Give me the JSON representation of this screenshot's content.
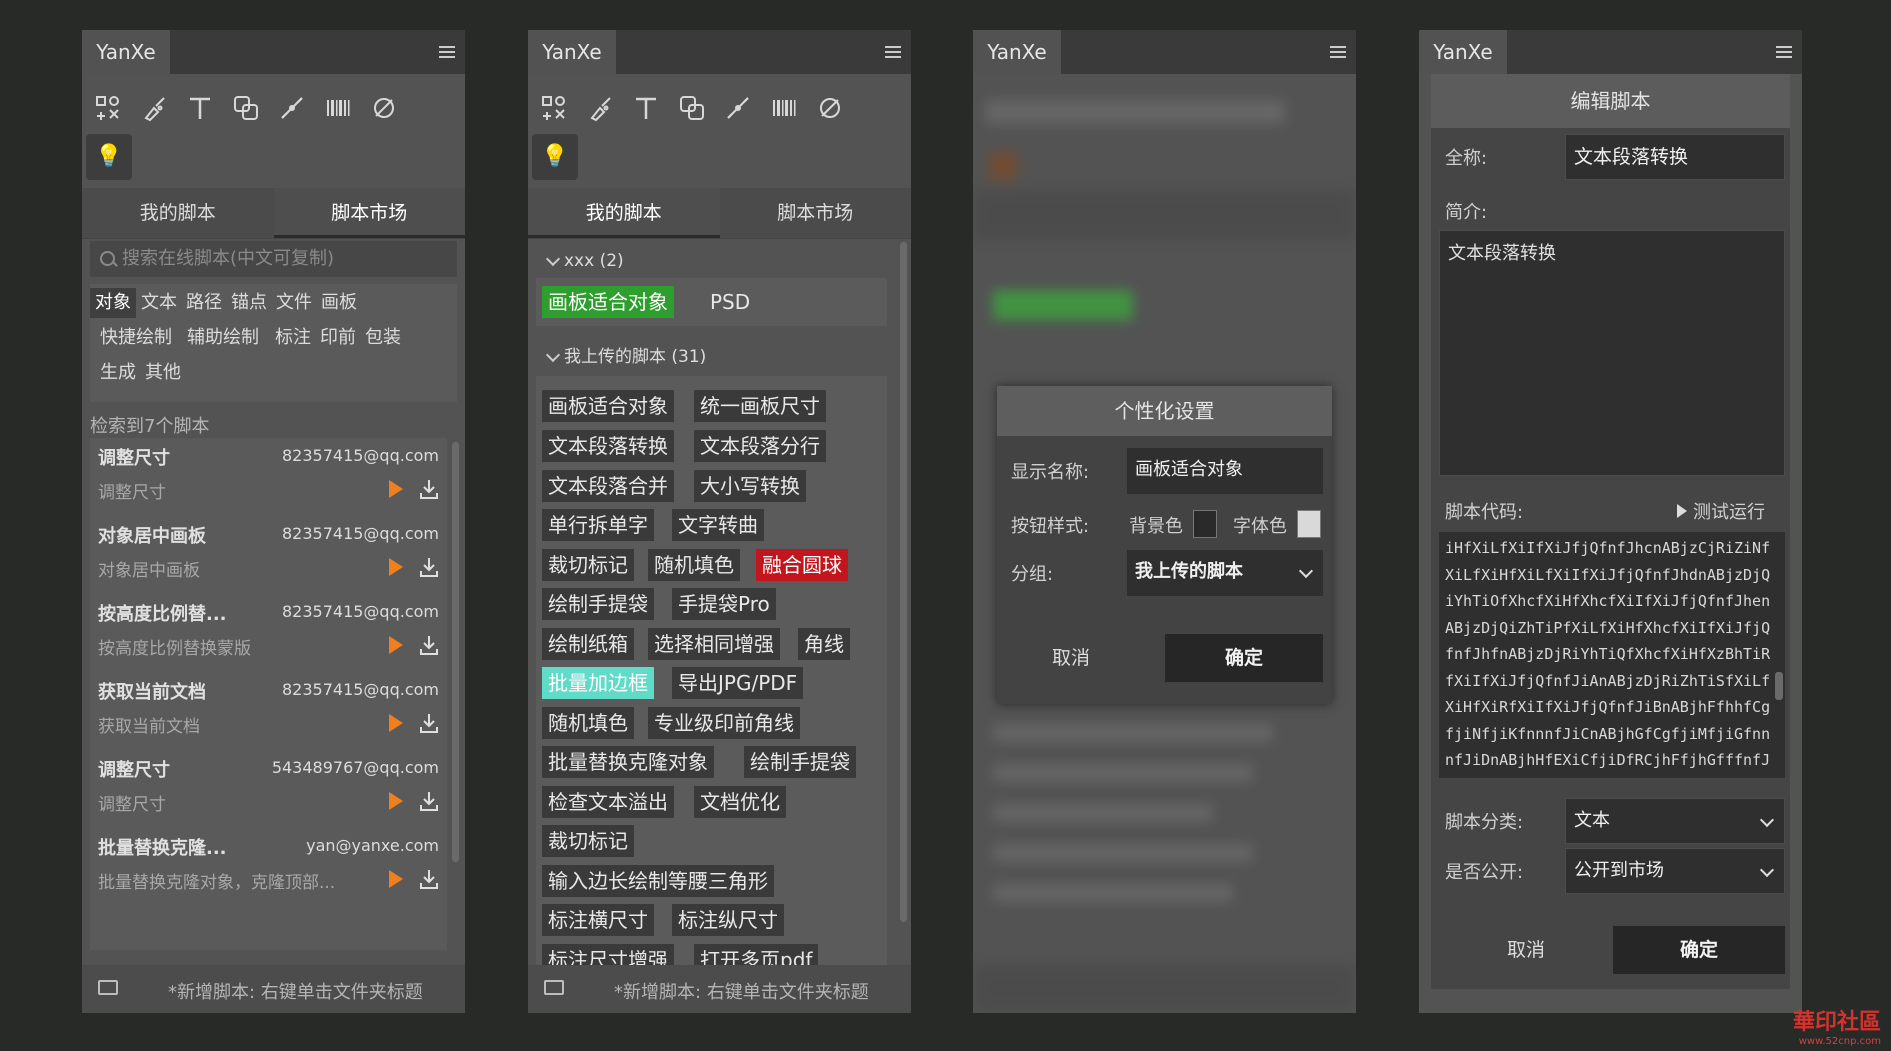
{
  "app_title": "YanXe",
  "tabs": {
    "my_scripts": "我的脚本",
    "market": "脚本市场"
  },
  "search": {
    "placeholder": "搜索在线脚本(中文可复制)"
  },
  "categories": [
    "对象",
    "文本",
    "路径",
    "锚点",
    "文件",
    "画板",
    "快捷绘制",
    "辅助绘制",
    "标注",
    "印前",
    "包装",
    "生成",
    "其他"
  ],
  "result_count": "检索到7个脚本",
  "market_list": [
    {
      "name": "调整尺寸",
      "email": "82357415@qq.com",
      "desc": "调整尺寸"
    },
    {
      "name": "对象居中画板",
      "email": "82357415@qq.com",
      "desc": "对象居中画板"
    },
    {
      "name": "按高度比例替...",
      "email": "82357415@qq.com",
      "desc": "按高度比例替换蒙版"
    },
    {
      "name": "获取当前文档",
      "email": "82357415@qq.com",
      "desc": "获取当前文档"
    },
    {
      "name": "调整尺寸",
      "email": "543489767@qq.com",
      "desc": "调整尺寸"
    },
    {
      "name": "批量替换克隆...",
      "email": "yan@yanxe.com",
      "desc": "批量替换克隆对象，克隆顶部..."
    }
  ],
  "footer_hint": "*新增脚本: 右键单击文件夹标题",
  "groups": {
    "g1_title": "xxx (2)",
    "g1_items": [
      "画板适合对象",
      "PSD"
    ],
    "g2_title": "我上传的脚本 (31)",
    "g2_items": [
      "画板适合对象",
      "统一画板尺寸",
      "文本段落转换",
      "文本段落分行",
      "文本段落合并",
      "大小写转换",
      "单行拆单字",
      "文字转曲",
      "裁切标记",
      "随机填色",
      "融合圆球",
      "绘制手提袋",
      "手提袋Pro",
      "绘制纸箱",
      "选择相同增强",
      "角线",
      "批量加边框",
      "导出JPG/PDF",
      "随机填色",
      "专业级印前角线",
      "批量替换克隆对象",
      "绘制手提袋",
      "检查文本溢出",
      "文档优化",
      "裁切标记",
      "输入边长绘制等腰三角形",
      "标注横尺寸",
      "标注纵尺寸",
      "标注尺寸增强",
      "打开多页pdf"
    ]
  },
  "dialog": {
    "title": "个性化设置",
    "display_name_label": "显示名称:",
    "display_name_value": "画板适合对象",
    "button_style_label": "按钮样式:",
    "bg_label": "背景色",
    "fg_label": "字体色",
    "bg_color": "#2a2a2a",
    "fg_color": "#d9d9d9",
    "group_label": "分组:",
    "group_value": "我上传的脚本",
    "cancel": "取消",
    "ok": "确定"
  },
  "editor": {
    "title": "编辑脚本",
    "full_name_label": "全称:",
    "full_name_value": "文本段落转换",
    "intro_label": "简介:",
    "intro_value": "文本段落转换",
    "code_label": "脚本代码:",
    "test_run": "测试运行",
    "code": "iHfXiLfXiIfXiJfjQfnfJhcnABjzCjRiZiNfXiLfXiHfXiLfXiIfXiJfjQfnfJhdnABjzDjQiYhTiOfXhcfXiHfXhcfXiIfXiJfjQfnfJhenABjzDjQiZhTiPfXiLfXiHfXhcfXiIfXiJfjQfnfJhfnABjzDjRiYhTiQfXhcfXiHfXzBhTiRfXiIfXiJfjQfnfJiAnABjzDjRiZhTiSfXiLfXiHfXiRfXiIfXiJfjQfnfJiBnABjhFfhhfCgfjiNfjiKfnnnfJiCnABjhGfCgfjiMfjiGfnnnfJiDnABjhHfEXiCfjiDfRCjhFfjhGfffnfJiEnABjhHfCgcChZCgcnj",
    "category_label": "脚本分类:",
    "category_value": "文本",
    "public_label": "是否公开:",
    "public_value": "公开到市场",
    "cancel": "取消",
    "ok": "确定"
  },
  "watermark": "華印社區",
  "watermark_url": "www.52cnp.com"
}
